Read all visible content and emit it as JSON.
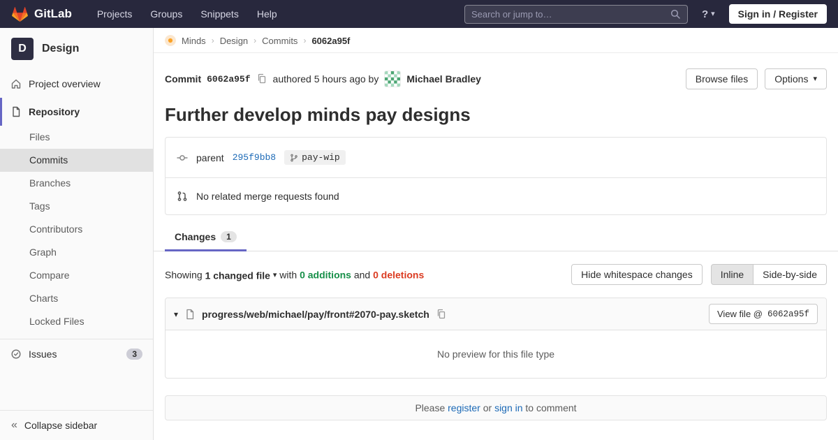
{
  "colors": {
    "navbar_bg": "#28283d",
    "accent_indigo": "#6666c4",
    "brand_orange": "#fc6d26",
    "link": "#1b69b6",
    "success": "#168f48",
    "danger": "#db3b21",
    "sidebar_bg": "#fafafa",
    "active_item_bg": "#e1e1e1"
  },
  "icons": {
    "caret_down": "▾",
    "breadcrumb_separator": "›",
    "collapse_chevrons": "«",
    "help": "?"
  },
  "navbar": {
    "brand": "GitLab",
    "menu": [
      {
        "label": "Projects"
      },
      {
        "label": "Groups"
      },
      {
        "label": "Snippets"
      },
      {
        "label": "Help"
      }
    ],
    "search_placeholder": "Search or jump to…",
    "sign_in_label": "Sign in / Register"
  },
  "sidebar": {
    "project_avatar_initial": "D",
    "project_name": "Design",
    "items_top": [
      {
        "label": "Project overview"
      },
      {
        "label": "Repository"
      }
    ],
    "repo_items": [
      {
        "label": "Files"
      },
      {
        "label": "Commits"
      },
      {
        "label": "Branches"
      },
      {
        "label": "Tags"
      },
      {
        "label": "Contributors"
      },
      {
        "label": "Graph"
      },
      {
        "label": "Compare"
      },
      {
        "label": "Charts"
      },
      {
        "label": "Locked Files"
      }
    ],
    "issues_label": "Issues",
    "issues_count": "3",
    "collapse_label": "Collapse sidebar"
  },
  "breadcrumb": {
    "items": [
      {
        "label": "Minds"
      },
      {
        "label": "Design"
      },
      {
        "label": "Commits"
      },
      {
        "label": "6062a95f"
      }
    ]
  },
  "commit": {
    "label": "Commit",
    "sha_short": "6062a95f",
    "authored_text": "authored 5 hours ago by",
    "author_name": "Michael Bradley",
    "browse_files_label": "Browse files",
    "options_label": "Options",
    "title": "Further develop minds pay designs",
    "parent_label": "parent",
    "parent_sha": "295f9bb8",
    "ref_name": "pay-wip",
    "no_related_mr_text": "No related merge requests found"
  },
  "tabs": {
    "changes_label": "Changes",
    "changes_count": "1"
  },
  "diff_summary": {
    "showing": "Showing",
    "changed_files": "1 changed file",
    "with": "with",
    "additions": "0 additions",
    "and": "and",
    "deletions": "0 deletions",
    "hide_whitespace_label": "Hide whitespace changes",
    "inline_label": "Inline",
    "side_by_side_label": "Side-by-side"
  },
  "diff_file": {
    "path": "progress/web/michael/pay/front#2070-pay.sketch",
    "view_file_label": "View file @",
    "view_file_sha": "6062a95f",
    "no_preview_text": "No preview for this file type"
  },
  "comment_bar": {
    "please": "Please",
    "register_label": "register",
    "or": "or",
    "sign_in_label": "sign in",
    "to_comment": "to comment"
  }
}
